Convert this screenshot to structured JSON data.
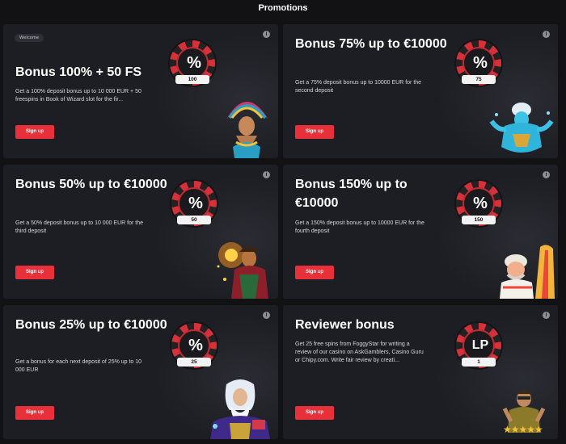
{
  "page": {
    "title": "Promotions"
  },
  "cards": [
    {
      "badge": "Welcome",
      "title": "Bonus 100% + 50 FS",
      "description": "Get a 100% deposit bonus up to 10 000 EUR + 50 freespins in Book of Wizard slot for the fir...",
      "chip_symbol": "%",
      "chip_value": "100",
      "button_label": "Sign up",
      "info_icon": "i",
      "art_icon": "aztec-queen-art"
    },
    {
      "title": "Bonus 75% up to €10000",
      "description": "Get a 75% deposit bonus up to 10000 EUR for the second deposit",
      "chip_symbol": "%",
      "chip_value": "75",
      "button_label": "Sign up",
      "info_icon": "i",
      "art_icon": "genie-art"
    },
    {
      "title": "Bonus 50% up to €10000",
      "description": "Get a 50% deposit bonus up to 10 000 EUR for the third deposit",
      "chip_symbol": "%",
      "chip_value": "50",
      "button_label": "Sign up",
      "info_icon": "i",
      "art_icon": "fire-wizard-art"
    },
    {
      "title": "Bonus 150% up to €10000",
      "description": "Get a 150% deposit bonus up to 10000 EUR for the fourth deposit",
      "chip_symbol": "%",
      "chip_value": "150",
      "button_label": "Sign up",
      "info_icon": "i",
      "art_icon": "surfer-art"
    },
    {
      "title": "Bonus 25% up to €10000",
      "description": "Get a bonus for each next deposit of 25% up to 10 000 EUR",
      "chip_symbol": "%",
      "chip_value": "25",
      "button_label": "Sign up",
      "info_icon": "i",
      "art_icon": "zeus-art"
    },
    {
      "title": "Reviewer bonus",
      "description": "Get 25 free spins from FoggyStar for writing a review of our casino on AskGamblers, Casino Guru or Chipy.com. Write fair review by creati...",
      "chip_symbol": "LP",
      "chip_value": "1",
      "button_label": "Sign up",
      "info_icon": "i",
      "art_icon": "reviewer-stars-art",
      "stars": "★★★★★"
    }
  ],
  "colors": {
    "accent": "#e8303a",
    "card_bg": "#1d1e23",
    "page_bg": "#121215"
  }
}
